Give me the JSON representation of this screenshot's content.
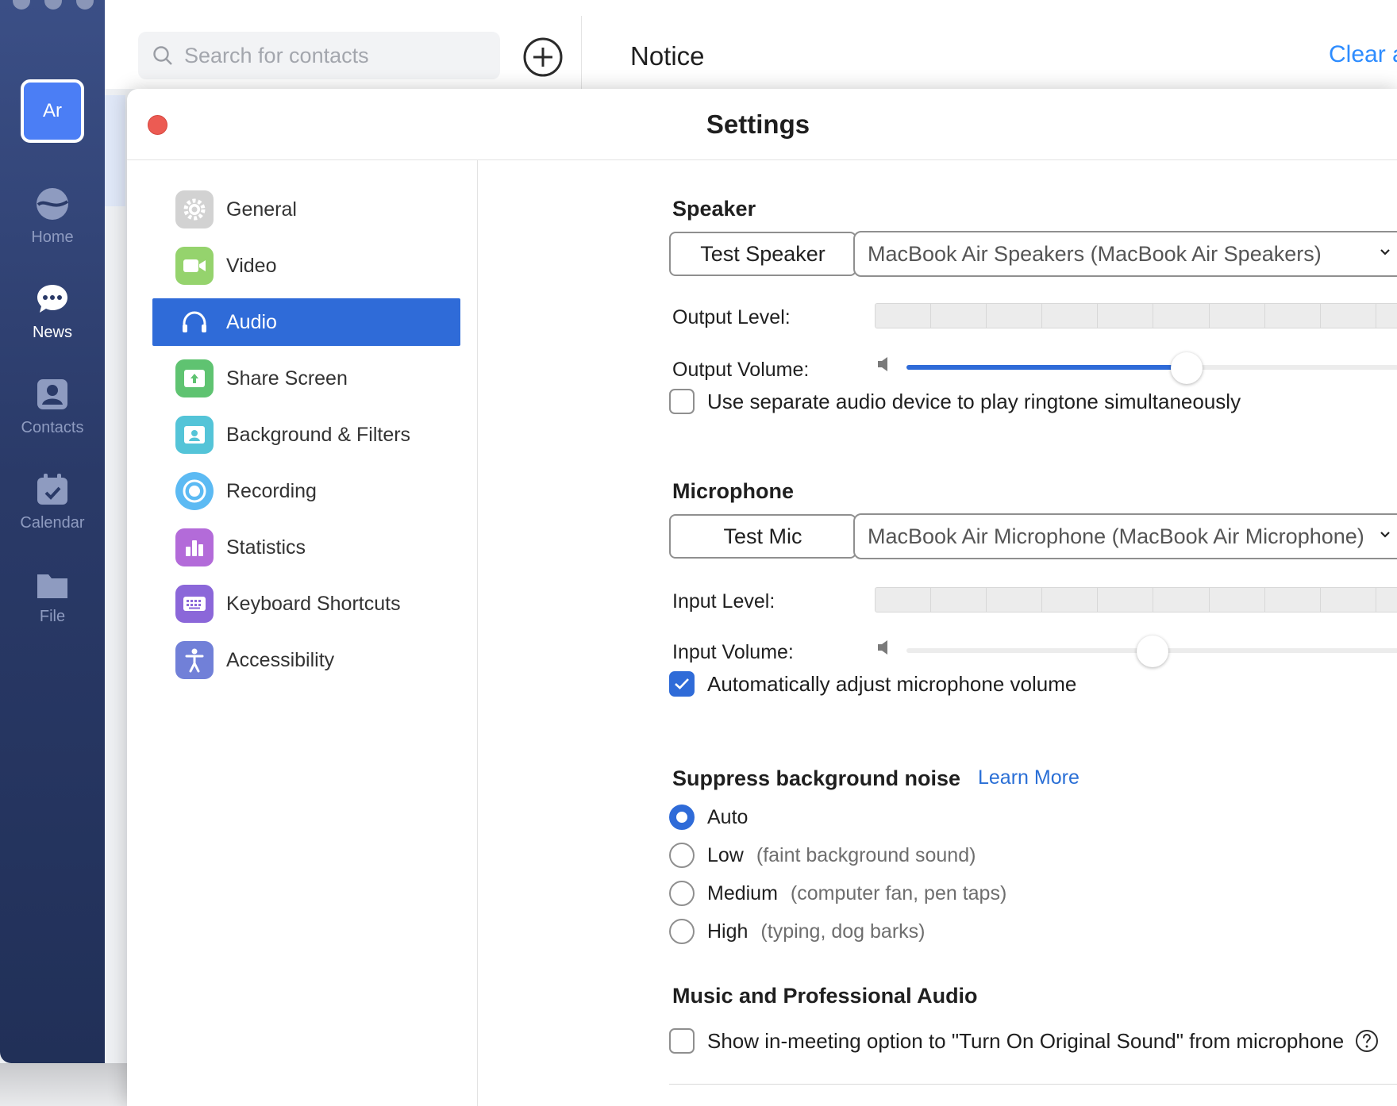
{
  "app": {
    "avatar_initials": "Ar",
    "nav": [
      {
        "label": "Home",
        "icon": "home-icon"
      },
      {
        "label": "News",
        "icon": "chat-icon"
      },
      {
        "label": "Contacts",
        "icon": "contacts-icon"
      },
      {
        "label": "Calendar",
        "icon": "calendar-icon"
      },
      {
        "label": "File",
        "icon": "folder-icon"
      }
    ],
    "active_nav": "News",
    "search": {
      "placeholder": "Search for contacts",
      "value": ""
    },
    "panel_title": "Notice",
    "clear_link": "Clear a"
  },
  "settings": {
    "title": "Settings",
    "menu": [
      {
        "label": "General",
        "icon": "gear-icon",
        "color": "#c9c9c9"
      },
      {
        "label": "Video",
        "icon": "video-camera-icon",
        "color": "#8fd16a"
      },
      {
        "label": "Audio",
        "icon": "headphones-icon",
        "color": "#2f6bd8"
      },
      {
        "label": "Share Screen",
        "icon": "share-screen-icon",
        "color": "#5cc16f"
      },
      {
        "label": "Background & Filters",
        "icon": "background-icon",
        "color": "#4ec3d6"
      },
      {
        "label": "Recording",
        "icon": "record-icon",
        "color": "#5ab8f2"
      },
      {
        "label": "Statistics",
        "icon": "bar-chart-icon",
        "color": "#b06ad8"
      },
      {
        "label": "Keyboard Shortcuts",
        "icon": "keyboard-icon",
        "color": "#8a64d8"
      },
      {
        "label": "Accessibility",
        "icon": "accessibility-icon",
        "color": "#6f7fd6"
      }
    ],
    "active_menu": "Audio",
    "audio": {
      "speaker": {
        "title": "Speaker",
        "test_button": "Test Speaker",
        "device": "MacBook Air Speakers (MacBook Air Speakers)",
        "output_level_label": "Output Level:",
        "output_volume_label": "Output Volume:",
        "output_volume": 0.57,
        "level_segments": 10
      },
      "separate_ringtone": {
        "label": "Use separate audio device to play ringtone simultaneously",
        "checked": false
      },
      "microphone": {
        "title": "Microphone",
        "test_button": "Test Mic",
        "device": "MacBook Air Microphone (MacBook Air Microphone)",
        "input_level_label": "Input Level:",
        "input_volume_label": "Input Volume:",
        "input_volume": 0.5,
        "level_segments": 10
      },
      "auto_adjust": {
        "label": "Automatically adjust microphone volume",
        "checked": true
      },
      "noise": {
        "title": "Suppress background noise",
        "learn_more": "Learn More",
        "options": [
          {
            "label": "Auto",
            "hint": "",
            "selected": true
          },
          {
            "label": "Low",
            "hint": "(faint background sound)",
            "selected": false
          },
          {
            "label": "Medium",
            "hint": "(computer fan, pen taps)",
            "selected": false
          },
          {
            "label": "High",
            "hint": "(typing, dog barks)",
            "selected": false
          }
        ]
      },
      "music": {
        "title": "Music and Professional Audio",
        "original_sound": {
          "label": "Show in-meeting option to \"Turn On Original Sound\" from microphone",
          "checked": false
        }
      }
    }
  },
  "colors": {
    "accent": "#2f6bd8",
    "link": "#2d8cff",
    "close": "#ec5b53"
  }
}
